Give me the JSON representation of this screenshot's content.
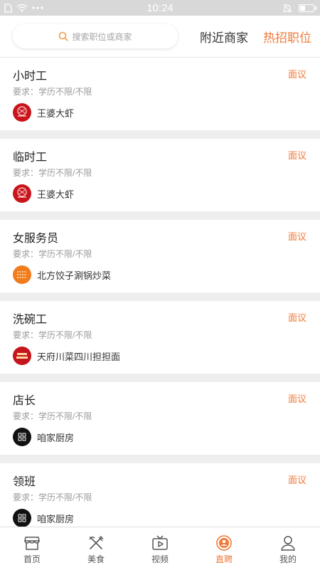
{
  "status_bar": {
    "time": "10:24"
  },
  "header": {
    "search_placeholder": "搜索职位或商家",
    "tabs": [
      {
        "label": "附近商家",
        "active": false
      },
      {
        "label": "热招职位",
        "active": true
      }
    ]
  },
  "jobs": [
    {
      "title": "小时工",
      "salary": "面议",
      "requirement": "要求：学历不限/不限",
      "shop": "王婆大虾",
      "logo_color": "#c8151d"
    },
    {
      "title": "临时工",
      "salary": "面议",
      "requirement": "要求：学历不限/不限",
      "shop": "王婆大虾",
      "logo_color": "#c8151d"
    },
    {
      "title": "女服务员",
      "salary": "面议",
      "requirement": "要求：学历不限/不限",
      "shop": "北方饺子涮锅炒菜",
      "logo_color": "#f07c1c"
    },
    {
      "title": "洗碗工",
      "salary": "面议",
      "requirement": "要求：学历不限/不限",
      "shop": "天府川菜四川担担面",
      "logo_color": "#c4161c"
    },
    {
      "title": "店长",
      "salary": "面议",
      "requirement": "要求：学历不限/不限",
      "shop": "咱家厨房",
      "logo_color": "#111111"
    },
    {
      "title": "领班",
      "salary": "面议",
      "requirement": "要求：学历不限/不限",
      "shop": "咱家厨房",
      "logo_color": "#111111"
    }
  ],
  "bottom_nav": [
    {
      "label": "首页",
      "icon": "home-icon",
      "active": false
    },
    {
      "label": "美食",
      "icon": "fork-knife-icon",
      "active": false
    },
    {
      "label": "视频",
      "icon": "tv-play-icon",
      "active": false
    },
    {
      "label": "直聘",
      "icon": "recruit-icon",
      "active": true
    },
    {
      "label": "我的",
      "icon": "user-icon",
      "active": false
    }
  ],
  "colors": {
    "accent": "#f07a3a",
    "status_bar": "#d8d8d8"
  }
}
